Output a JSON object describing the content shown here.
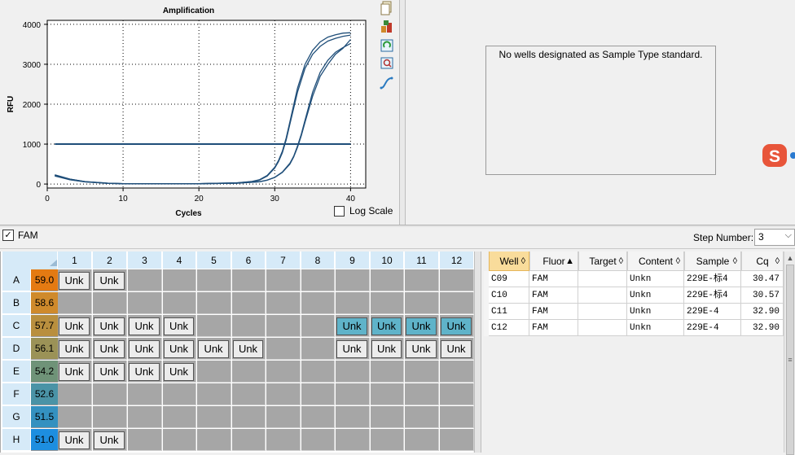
{
  "chart_data": {
    "type": "line",
    "title": "Amplification",
    "xlabel": "Cycles",
    "ylabel": "RFU",
    "xlim": [
      0,
      42
    ],
    "ylim": [
      -100,
      4100
    ],
    "xticks": [
      0,
      10,
      20,
      30,
      40
    ],
    "yticks": [
      0,
      1000,
      2000,
      3000,
      4000
    ],
    "grid": true,
    "threshold": 1000,
    "series": [
      {
        "x": [
          1,
          3,
          5,
          8,
          10,
          15,
          20,
          25,
          27,
          28,
          29,
          30,
          30.5,
          31,
          31.5,
          32,
          33,
          34,
          35,
          36,
          37,
          38,
          39,
          40
        ],
        "values": [
          220,
          120,
          60,
          20,
          10,
          5,
          10,
          30,
          60,
          100,
          200,
          400,
          560,
          780,
          1100,
          1500,
          2300,
          2900,
          3250,
          3450,
          3580,
          3650,
          3700,
          3730
        ]
      },
      {
        "x": [
          1,
          3,
          5,
          8,
          10,
          15,
          20,
          25,
          27,
          28,
          29,
          30,
          30.5,
          31,
          31.5,
          32,
          33,
          34,
          35,
          36,
          37,
          38,
          39,
          40
        ],
        "values": [
          230,
          125,
          62,
          22,
          10,
          5,
          10,
          30,
          65,
          110,
          215,
          420,
          590,
          820,
          1150,
          1560,
          2400,
          3000,
          3350,
          3560,
          3680,
          3740,
          3780,
          3790
        ]
      },
      {
        "x": [
          1,
          3,
          5,
          8,
          10,
          15,
          20,
          25,
          28,
          29,
          30,
          31,
          32,
          32.5,
          33,
          33.5,
          34,
          35,
          36,
          37,
          38,
          39,
          40
        ],
        "values": [
          210,
          110,
          55,
          18,
          8,
          5,
          8,
          20,
          60,
          100,
          170,
          300,
          520,
          700,
          950,
          1250,
          1600,
          2300,
          2800,
          3100,
          3300,
          3420,
          3520
        ]
      },
      {
        "x": [
          1,
          3,
          5,
          8,
          10,
          15,
          20,
          25,
          28,
          29,
          30,
          31,
          32,
          32.5,
          33,
          33.5,
          34,
          35,
          36,
          37,
          38,
          39,
          40
        ],
        "values": [
          200,
          105,
          52,
          17,
          8,
          5,
          8,
          20,
          58,
          95,
          165,
          290,
          500,
          680,
          920,
          1210,
          1550,
          2200,
          2700,
          3000,
          3250,
          3400,
          3620
        ]
      }
    ],
    "color": "#1f4e79"
  },
  "toolbar": {
    "icons": [
      "copy-icon",
      "export-icon",
      "refresh-icon",
      "zoom-icon",
      "curve-icon"
    ]
  },
  "log_scale_label": "Log Scale",
  "standard_message": "No wells designated as Sample Type standard.",
  "fam_label": "FAM",
  "step_label": "Step Number:",
  "step_value": "3",
  "plate": {
    "columns": [
      "1",
      "2",
      "3",
      "4",
      "5",
      "6",
      "7",
      "8",
      "9",
      "10",
      "11",
      "12"
    ],
    "rows": [
      {
        "label": "A",
        "temp": "59.0",
        "temp_color": "#e47a12",
        "wells": [
          "Unk",
          "Unk",
          "",
          "",
          "",
          "",
          "",
          "",
          "",
          "",
          "",
          ""
        ],
        "selected": []
      },
      {
        "label": "B",
        "temp": "58.6",
        "temp_color": "#cf8a2c",
        "wells": [
          "",
          "",
          "",
          "",
          "",
          "",
          "",
          "",
          "",
          "",
          "",
          ""
        ],
        "selected": []
      },
      {
        "label": "C",
        "temp": "57.7",
        "temp_color": "#b98f3e",
        "wells": [
          "Unk",
          "Unk",
          "Unk",
          "Unk",
          "",
          "",
          "",
          "",
          "Unk",
          "Unk",
          "Unk",
          "Unk"
        ],
        "selected": [
          8,
          9,
          10,
          11
        ]
      },
      {
        "label": "D",
        "temp": "56.1",
        "temp_color": "#9b9257",
        "wells": [
          "Unk",
          "Unk",
          "Unk",
          "Unk",
          "Unk",
          "Unk",
          "",
          "",
          "Unk",
          "Unk",
          "Unk",
          "Unk"
        ],
        "selected": []
      },
      {
        "label": "E",
        "temp": "54.2",
        "temp_color": "#6f9378",
        "wells": [
          "Unk",
          "Unk",
          "Unk",
          "Unk",
          "",
          "",
          "",
          "",
          "",
          "",
          "",
          ""
        ],
        "selected": []
      },
      {
        "label": "F",
        "temp": "52.6",
        "temp_color": "#4a93a6",
        "wells": [
          "",
          "",
          "",
          "",
          "",
          "",
          "",
          "",
          "",
          "",
          "",
          ""
        ],
        "selected": []
      },
      {
        "label": "G",
        "temp": "51.5",
        "temp_color": "#3491c0",
        "wells": [
          "",
          "",
          "",
          "",
          "",
          "",
          "",
          "",
          "",
          "",
          "",
          ""
        ],
        "selected": []
      },
      {
        "label": "H",
        "temp": "51.0",
        "temp_color": "#1d8ee0",
        "wells": [
          "Unk",
          "Unk",
          "",
          "",
          "",
          "",
          "",
          "",
          "",
          "",
          "",
          ""
        ],
        "selected": []
      }
    ]
  },
  "results": {
    "headers": [
      "Well",
      "Fluor",
      "Target",
      "Content",
      "Sample",
      "Cq"
    ],
    "sort_icons": [
      "◊",
      "▲",
      "◊",
      "◊",
      "◊",
      "◊"
    ],
    "rows": [
      [
        "C09",
        "FAM",
        "",
        "Unkn",
        "229E-标4",
        "30.47"
      ],
      [
        "C10",
        "FAM",
        "",
        "Unkn",
        "229E-标4",
        "30.57"
      ],
      [
        "C11",
        "FAM",
        "",
        "Unkn",
        "229E-4",
        "32.90"
      ],
      [
        "C12",
        "FAM",
        "",
        "Unkn",
        "229E-4",
        "32.90"
      ]
    ]
  }
}
